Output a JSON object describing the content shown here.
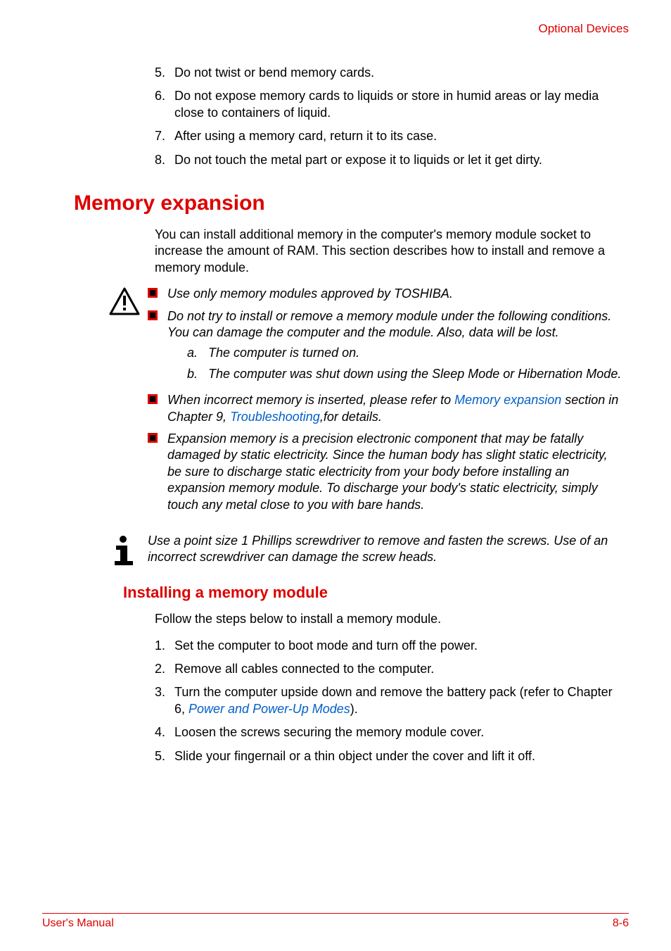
{
  "header": {
    "section": "Optional Devices"
  },
  "top_list": [
    {
      "n": "5.",
      "t": "Do not twist or bend memory cards."
    },
    {
      "n": "6.",
      "t": "Do not expose memory cards to liquids or store in humid areas or lay media close to containers of liquid."
    },
    {
      "n": "7.",
      "t": "After using a memory card, return it to its case."
    },
    {
      "n": "8.",
      "t": "Do not touch the metal part or expose it to liquids or let it get dirty."
    }
  ],
  "h1": "Memory expansion",
  "intro": "You can install additional memory in the computer's memory module socket to increase the amount of RAM. This section describes how to install and remove a memory module.",
  "warn_bullets": [
    {
      "t": "Use only memory modules approved by TOSHIBA."
    },
    {
      "t": "Do not try to install or remove a memory module under the following conditions. You can damage the computer and the module. Also, data will be lost.",
      "sub": [
        {
          "l": "a.",
          "t": "The computer is turned on."
        },
        {
          "l": "b.",
          "t": "The computer was shut down using the Sleep Mode or Hibernation Mode."
        }
      ]
    },
    {
      "pre": "When incorrect memory is inserted, please refer to ",
      "link1": "Memory expansion",
      "mid": " section in Chapter 9, ",
      "link2": "Troubleshooting",
      "post": ",for details."
    },
    {
      "t": "Expansion memory is a precision electronic component that may be fatally damaged by static electricity. Since the human body has slight static electricity, be sure to discharge static electricity from your body before installing an expansion memory module. To discharge your body's static electricity, simply touch any metal close to you with bare hands."
    }
  ],
  "info_note": "Use a point size 1 Phillips screwdriver to remove and fasten the screws. Use of an incorrect screwdriver can damage the screw heads.",
  "h2": "Installing a memory module",
  "install_intro": "Follow the steps below to install a memory module.",
  "install_steps": [
    {
      "n": "1.",
      "t": "Set the computer to boot mode and turn off the power."
    },
    {
      "n": "2.",
      "t": "Remove all cables connected to the computer."
    },
    {
      "n": "3.",
      "pre": "Turn the computer upside down and remove the battery pack (refer to Chapter 6, ",
      "link": "Power and Power-Up Modes",
      "post": ")."
    },
    {
      "n": "4.",
      "t": "Loosen the screws securing the memory module cover."
    },
    {
      "n": "5.",
      "t": "Slide your fingernail or a thin object under the cover and lift it off."
    }
  ],
  "footer": {
    "left": "User's Manual",
    "right": "8-6"
  }
}
